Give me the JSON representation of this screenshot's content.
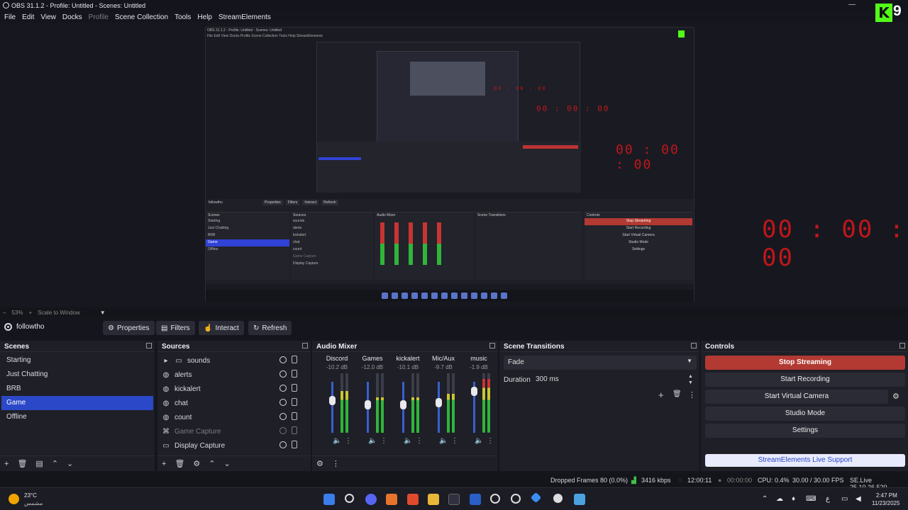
{
  "window": {
    "title": "OBS 31.1.2 - Profile: Untitled - Scenes: Untitled",
    "minimize": "—"
  },
  "menu": [
    "File",
    "Edit",
    "View",
    "Docks",
    "Profile",
    "Scene Collection",
    "Tools",
    "Help",
    "StreamElements"
  ],
  "overlay": {
    "kick_logo": "K",
    "kick_count": "9"
  },
  "preview": {
    "timer_large": "00 : 00 : 00",
    "timer_medium": "00 : 00 : 00",
    "timer_small": "00 : 00 : 00",
    "timer_tiny": "00 : 00 : 00",
    "inner_title": "OBS 31.1.2 - Profile: Untitled - Scenes: Untitled",
    "inner_menu": "File   Edit   View   Docks   Profile   Scene Collection   Tools   Help   StreamElements",
    "inner_source": "followtho",
    "inner_buttons": [
      "Properties",
      "Filters",
      "Interact",
      "Refresh"
    ],
    "inner_scenes": [
      "Starting",
      "Just Chatting",
      "BRB",
      "Game",
      "Offline"
    ],
    "inner_sources": [
      "sounds",
      "alerts",
      "kickalert",
      "chat",
      "count",
      "Game Capture",
      "Display Capture"
    ],
    "inner_controls": [
      "Stop Streaming",
      "Start Recording",
      "Start Virtual Camera",
      "Studio Mode",
      "Settings"
    ],
    "inner_headers": [
      "Scenes",
      "Sources",
      "Audio Mixer",
      "Scene Transitions",
      "Controls"
    ]
  },
  "zoom": {
    "level": "53%",
    "scale_label": "Scale to Window"
  },
  "toolbar": {
    "source_name": "followtho",
    "properties": "Properties",
    "filters": "Filters",
    "interact": "Interact",
    "refresh": "Refresh"
  },
  "scenes": {
    "title": "Scenes",
    "items": [
      "Starting",
      "Just Chatting",
      "BRB",
      "Game",
      "Offline"
    ],
    "selected": "Game"
  },
  "sources": {
    "title": "Sources",
    "items": [
      {
        "name": "sounds",
        "icon": "folder-icon"
      },
      {
        "name": "alerts",
        "icon": "globe-icon"
      },
      {
        "name": "kickalert",
        "icon": "globe-icon"
      },
      {
        "name": "chat",
        "icon": "globe-icon"
      },
      {
        "name": "count",
        "icon": "globe-icon"
      },
      {
        "name": "Game Capture",
        "icon": "gamepad-icon",
        "hidden": true
      },
      {
        "name": "Display Capture",
        "icon": "monitor-icon"
      }
    ]
  },
  "mixer": {
    "title": "Audio Mixer",
    "channels": [
      {
        "name": "Discord",
        "db": "-10.2 dB",
        "level": 0.7
      },
      {
        "name": "Games",
        "db": "-12.0 dB",
        "level": 0.6
      },
      {
        "name": "kickalert",
        "db": "-10.1 dB",
        "level": 0.6
      },
      {
        "name": "Mic/Aux",
        "db": "-9.7 dB",
        "level": 0.65
      },
      {
        "name": "music",
        "db": "-1.9 dB",
        "level": 0.9
      }
    ],
    "scale": [
      "0",
      "-5",
      "-10",
      "-15",
      "-20",
      "-25",
      "-30",
      "-35",
      "-40",
      "-45",
      "-50",
      "-55",
      "-60"
    ]
  },
  "transitions": {
    "title": "Scene Transitions",
    "selected": "Fade",
    "duration_label": "Duration",
    "duration_value": "300 ms"
  },
  "controls": {
    "title": "Controls",
    "stop_streaming": "Stop Streaming",
    "start_recording": "Start Recording",
    "start_virtual_camera": "Start Virtual Camera",
    "studio_mode": "Studio Mode",
    "settings": "Settings",
    "support": "StreamElements Live Support"
  },
  "status": {
    "dropped": "Dropped Frames 80 (0.0%)",
    "bitrate": "3416 kbps",
    "stream_time": "12:00:11",
    "rec_time": "00:00:00",
    "cpu": "CPU: 0.4%",
    "fps": "30.00 / 30.00 FPS",
    "version": "SE.Live 25.10.26.520"
  },
  "taskbar": {
    "weather_temp": "23°C",
    "weather_desc": "مشمس",
    "time": "2:47 PM",
    "date": "11/23/2025",
    "lang": "ع"
  }
}
